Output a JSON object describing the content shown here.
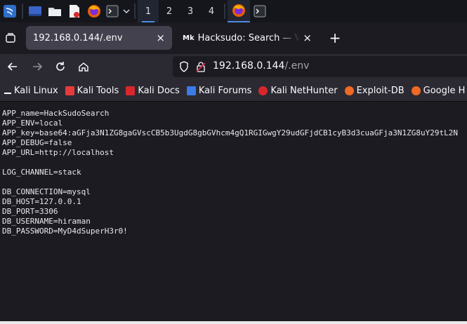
{
  "taskbar": {
    "workspaces": [
      "1",
      "2",
      "3",
      "4"
    ],
    "active_workspace": "1"
  },
  "tabs": [
    {
      "label": "192.168.0.144/.env",
      "active": true,
      "close": "×"
    },
    {
      "label": "Hacksudo: Search — Vuln",
      "active": false,
      "close": "×",
      "favicon_text": "Mk"
    }
  ],
  "new_tab_label": "+",
  "url": {
    "host": "192.168.0.144",
    "path": "/.env"
  },
  "bookmarks": [
    {
      "label": "Kali Linux",
      "color": "#ffffff"
    },
    {
      "label": "Kali Tools",
      "color": "#e73b3b"
    },
    {
      "label": "Kali Docs",
      "color": "#d9262c"
    },
    {
      "label": "Kali Forums",
      "color": "#3b7be7"
    },
    {
      "label": "Kali NetHunter",
      "color": "#d9262c"
    },
    {
      "label": "Exploit-DB",
      "color": "#f06a24"
    },
    {
      "label": "Google H",
      "color": "#f06a24"
    }
  ],
  "env_text": "APP_name=HackSudoSearch\nAPP_ENV=local\nAPP_key=base64:aGFja3N1ZG8gaGVscCB5b3UgdG8gbGVhcm4gQ1RGIGwgY29udGFjdCB1cyB3d3cuaGFja3N1ZG8uY29tL2N\nAPP_DEBUG=false\nAPP_URL=http://localhost\n\nLOG_CHANNEL=stack\n\nDB_CONNECTION=mysql\nDB_HOST=127.0.0.1\nDB_PORT=3306\nDB_USERNAME=hiraman\nDB_PASSWORD=MyD4dSuperH3r0!"
}
